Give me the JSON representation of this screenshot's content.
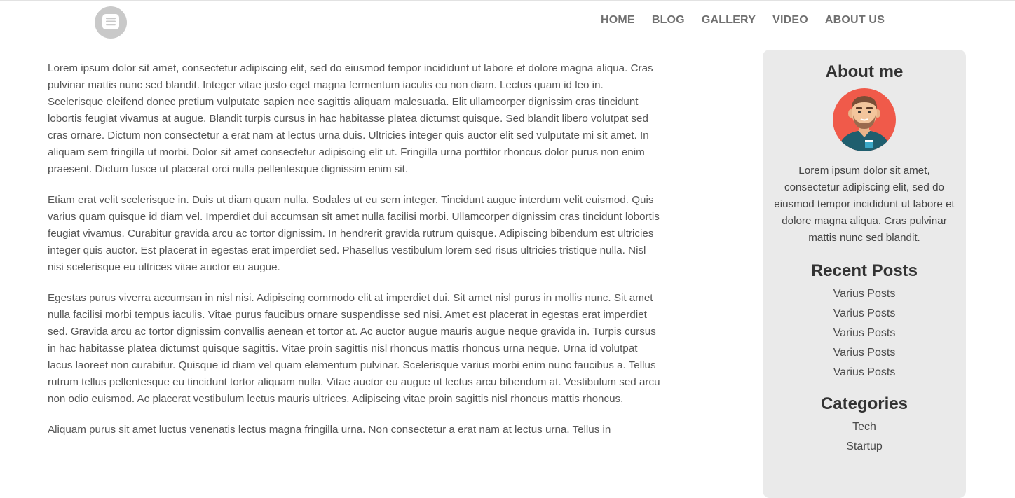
{
  "nav": {
    "items": [
      "HOME",
      "BLOG",
      "GALLERY",
      "VIDEO",
      "ABOUT US"
    ]
  },
  "logo": {
    "icon": "chat-bubble-icon"
  },
  "article": {
    "paragraphs": [
      "Lorem ipsum dolor sit amet, consectetur adipiscing elit, sed do eiusmod tempor incididunt ut labore et dolore magna aliqua. Cras pulvinar mattis nunc sed blandit. Integer vitae justo eget magna fermentum iaculis eu non diam. Lectus quam id leo in. Scelerisque eleifend donec pretium vulputate sapien nec sagittis aliquam malesuada. Elit ullamcorper dignissim cras tincidunt lobortis feugiat vivamus at augue. Blandit turpis cursus in hac habitasse platea dictumst quisque. Sed blandit libero volutpat sed cras ornare. Dictum non consectetur a erat nam at lectus urna duis. Ultricies integer quis auctor elit sed vulputate mi sit amet. In aliquam sem fringilla ut morbi. Dolor sit amet consectetur adipiscing elit ut. Fringilla urna porttitor rhoncus dolor purus non enim praesent. Dictum fusce ut placerat orci nulla pellentesque dignissim enim sit.",
      "Etiam erat velit scelerisque in. Duis ut diam quam nulla. Sodales ut eu sem integer. Tincidunt augue interdum velit euismod. Quis varius quam quisque id diam vel. Imperdiet dui accumsan sit amet nulla facilisi morbi. Ullamcorper dignissim cras tincidunt lobortis feugiat vivamus. Curabitur gravida arcu ac tortor dignissim. In hendrerit gravida rutrum quisque. Adipiscing bibendum est ultricies integer quis auctor. Est placerat in egestas erat imperdiet sed. Phasellus vestibulum lorem sed risus ultricies tristique nulla. Nisl nisi scelerisque eu ultrices vitae auctor eu augue.",
      "Egestas purus viverra accumsan in nisl nisi. Adipiscing commodo elit at imperdiet dui. Sit amet nisl purus in mollis nunc. Sit amet nulla facilisi morbi tempus iaculis. Vitae purus faucibus ornare suspendisse sed nisi. Amet est placerat in egestas erat imperdiet sed. Gravida arcu ac tortor dignissim convallis aenean et tortor at. Ac auctor augue mauris augue neque gravida in. Turpis cursus in hac habitasse platea dictumst quisque sagittis. Vitae proin sagittis nisl rhoncus mattis rhoncus urna neque. Urna id volutpat lacus laoreet non curabitur. Quisque id diam vel quam elementum pulvinar. Scelerisque varius morbi enim nunc faucibus a. Tellus rutrum tellus pellentesque eu tincidunt tortor aliquam nulla. Vitae auctor eu augue ut lectus arcu bibendum at. Vestibulum sed arcu non odio euismod. Ac placerat vestibulum lectus mauris ultrices. Adipiscing vitae proin sagittis nisl rhoncus mattis rhoncus.",
      "Aliquam purus sit amet luctus venenatis lectus magna fringilla urna. Non consectetur a erat nam at lectus urna. Tellus in"
    ]
  },
  "sidebar": {
    "about_title": "About me",
    "avatar_icon": "user-avatar-icon",
    "about_text": "Lorem ipsum dolor sit amet, consectetur adipiscing elit, sed do eiusmod tempor incididunt ut labore et dolore magna aliqua. Cras pulvinar mattis nunc sed blandit.",
    "recent_title": "Recent Posts",
    "recent_posts": [
      "Varius Posts",
      "Varius Posts",
      "Varius Posts",
      "Varius Posts",
      "Varius Posts"
    ],
    "categories_title": "Categories",
    "categories": [
      "Tech",
      "Startup"
    ]
  },
  "colors": {
    "sidebar_bg": "#eaeaea",
    "nav_text": "#707070",
    "avatar_bg": "#f05a4a",
    "shirt": "#1f5e6e"
  }
}
